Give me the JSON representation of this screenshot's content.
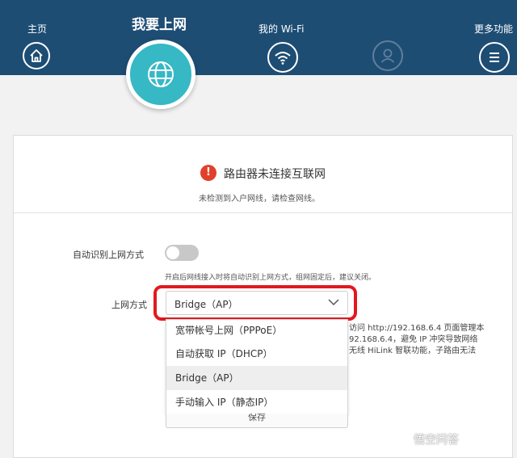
{
  "nav": {
    "home_label": "主页",
    "internet_label": "我要上网",
    "wifi_label": "我的 Wi-Fi",
    "more_label": "更多功能"
  },
  "status": {
    "title": "路由器未连接互联网",
    "subtitle": "未检测到入户网线，请检查网线。"
  },
  "auto_detect": {
    "label": "自动识别上网方式",
    "enabled": false,
    "hint": "开启后网线接入时将自动识别上网方式，组网固定后，建议关闭。"
  },
  "mode": {
    "label": "上网方式",
    "selected": "Bridge（AP）",
    "options": [
      "宽带帐号上网（PPPoE）",
      "自动获取 IP（DHCP）",
      "Bridge（AP）",
      "手动输入 IP（静态IP）"
    ]
  },
  "info": {
    "line1": "访问 http://192.168.6.4 页面管理本",
    "line2": "92.168.6.4，避免 IP 冲突导致网络",
    "line3": "无线 HiLink 智联功能，子路由无法"
  },
  "save_label": "保存",
  "watermark": "悟空问答",
  "colors": {
    "header": "#1e4d74",
    "accent": "#36b8c5",
    "alert": "#e0412a",
    "highlight": "#e1191f"
  }
}
